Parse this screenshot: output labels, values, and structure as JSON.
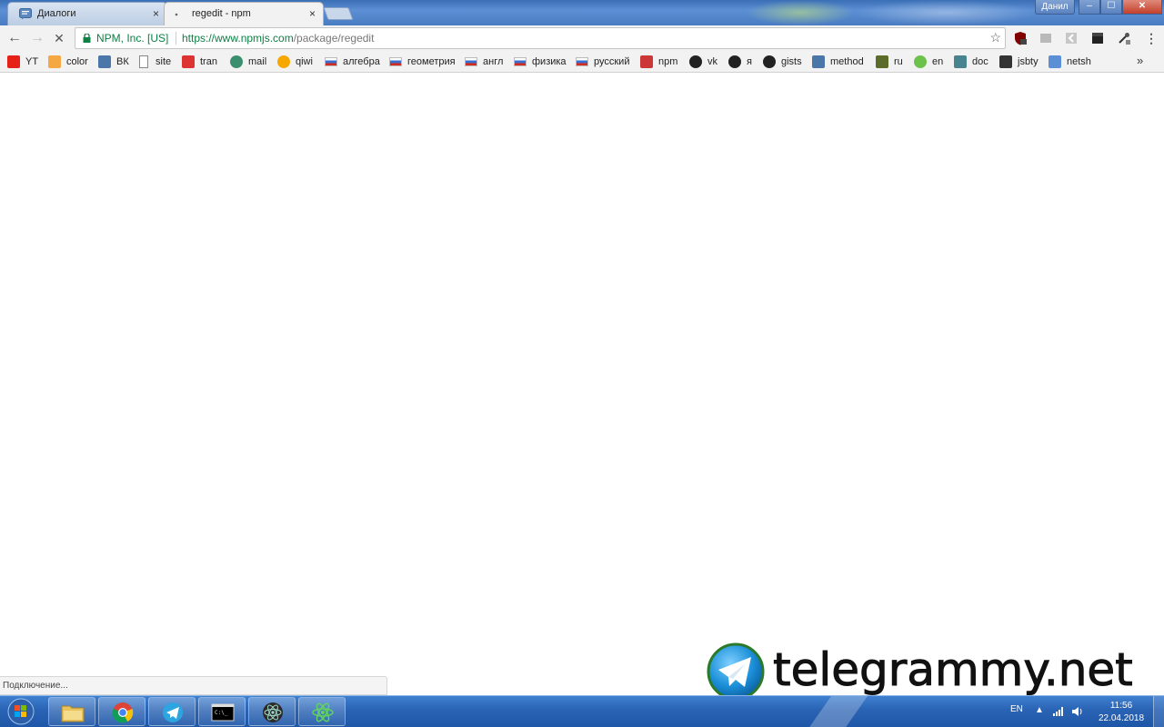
{
  "window": {
    "user_name": "Данил",
    "controls": {
      "minimize": "‒",
      "maximize": "☐",
      "close": "✕"
    }
  },
  "tabs": [
    {
      "title": "Диалоги",
      "close": "×",
      "icon": "vk-messages-icon"
    },
    {
      "title": "regedit - npm",
      "close": "×",
      "icon": "loading-dot-icon",
      "active": true
    }
  ],
  "toolbar": {
    "back": "←",
    "forward": "→",
    "stop": "✕",
    "security_name": "NPM, Inc. [US]",
    "url_host": "https://www.npmjs.com",
    "url_path": "/package/regedit",
    "bookmark_star": "☆"
  },
  "bookmarks": [
    {
      "label": "YT",
      "icon": "youtube-icon",
      "color": "#e62117"
    },
    {
      "label": "color",
      "icon": "color-icon",
      "color": "#f4a742"
    },
    {
      "label": "ВК",
      "icon": "vk-icon",
      "color": "#4a76a8"
    },
    {
      "label": "site",
      "icon": "page-icon",
      "color": "#888888"
    },
    {
      "label": "tran",
      "icon": "translate-icon",
      "color": "#d33"
    },
    {
      "label": "mail",
      "icon": "mail-icon",
      "color": "#3a8f6e"
    },
    {
      "label": "qiwi",
      "icon": "qiwi-icon",
      "color": "#f7a800"
    },
    {
      "label": "алгебра",
      "icon": "flag-icon",
      "color": "#3b6fcf"
    },
    {
      "label": "геометрия",
      "icon": "flag-icon",
      "color": "#3b6fcf"
    },
    {
      "label": "англ",
      "icon": "flag-icon",
      "color": "#3b6fcf"
    },
    {
      "label": "физика",
      "icon": "flag-icon",
      "color": "#3b6fcf"
    },
    {
      "label": "русский",
      "icon": "flag-icon",
      "color": "#3b6fcf"
    },
    {
      "label": "npm",
      "icon": "npm-icon",
      "color": "#cb3837"
    },
    {
      "label": "vk",
      "icon": "github-icon",
      "color": "#222222"
    },
    {
      "label": "я",
      "icon": "github-icon",
      "color": "#222222"
    },
    {
      "label": "gists",
      "icon": "github-icon",
      "color": "#222222"
    },
    {
      "label": "method",
      "icon": "vk-icon",
      "color": "#4a76a8"
    },
    {
      "label": "ru",
      "icon": "book-icon",
      "color": "#5a6b2a"
    },
    {
      "label": "en",
      "icon": "node-icon",
      "color": "#6cc24a"
    },
    {
      "label": "doc",
      "icon": "atom-icon",
      "color": "#47848f"
    },
    {
      "label": "jsbty",
      "icon": "cat-icon",
      "color": "#333333"
    },
    {
      "label": "netsh",
      "icon": "windows-icon",
      "color": "#5b8fd6"
    }
  ],
  "bookmarks_more": "»",
  "status": "Подключение...",
  "watermark": "telegrammy.net",
  "taskbar": {
    "apps": [
      {
        "name": "explorer",
        "icon": "folder-icon"
      },
      {
        "name": "chrome",
        "icon": "chrome-icon"
      },
      {
        "name": "telegram",
        "icon": "telegram-icon"
      },
      {
        "name": "cmd",
        "icon": "terminal-icon"
      },
      {
        "name": "atom",
        "icon": "atom-icon"
      },
      {
        "name": "electron",
        "icon": "react-icon"
      }
    ],
    "lang": "EN",
    "time": "11:56",
    "date": "22.04.2018"
  }
}
